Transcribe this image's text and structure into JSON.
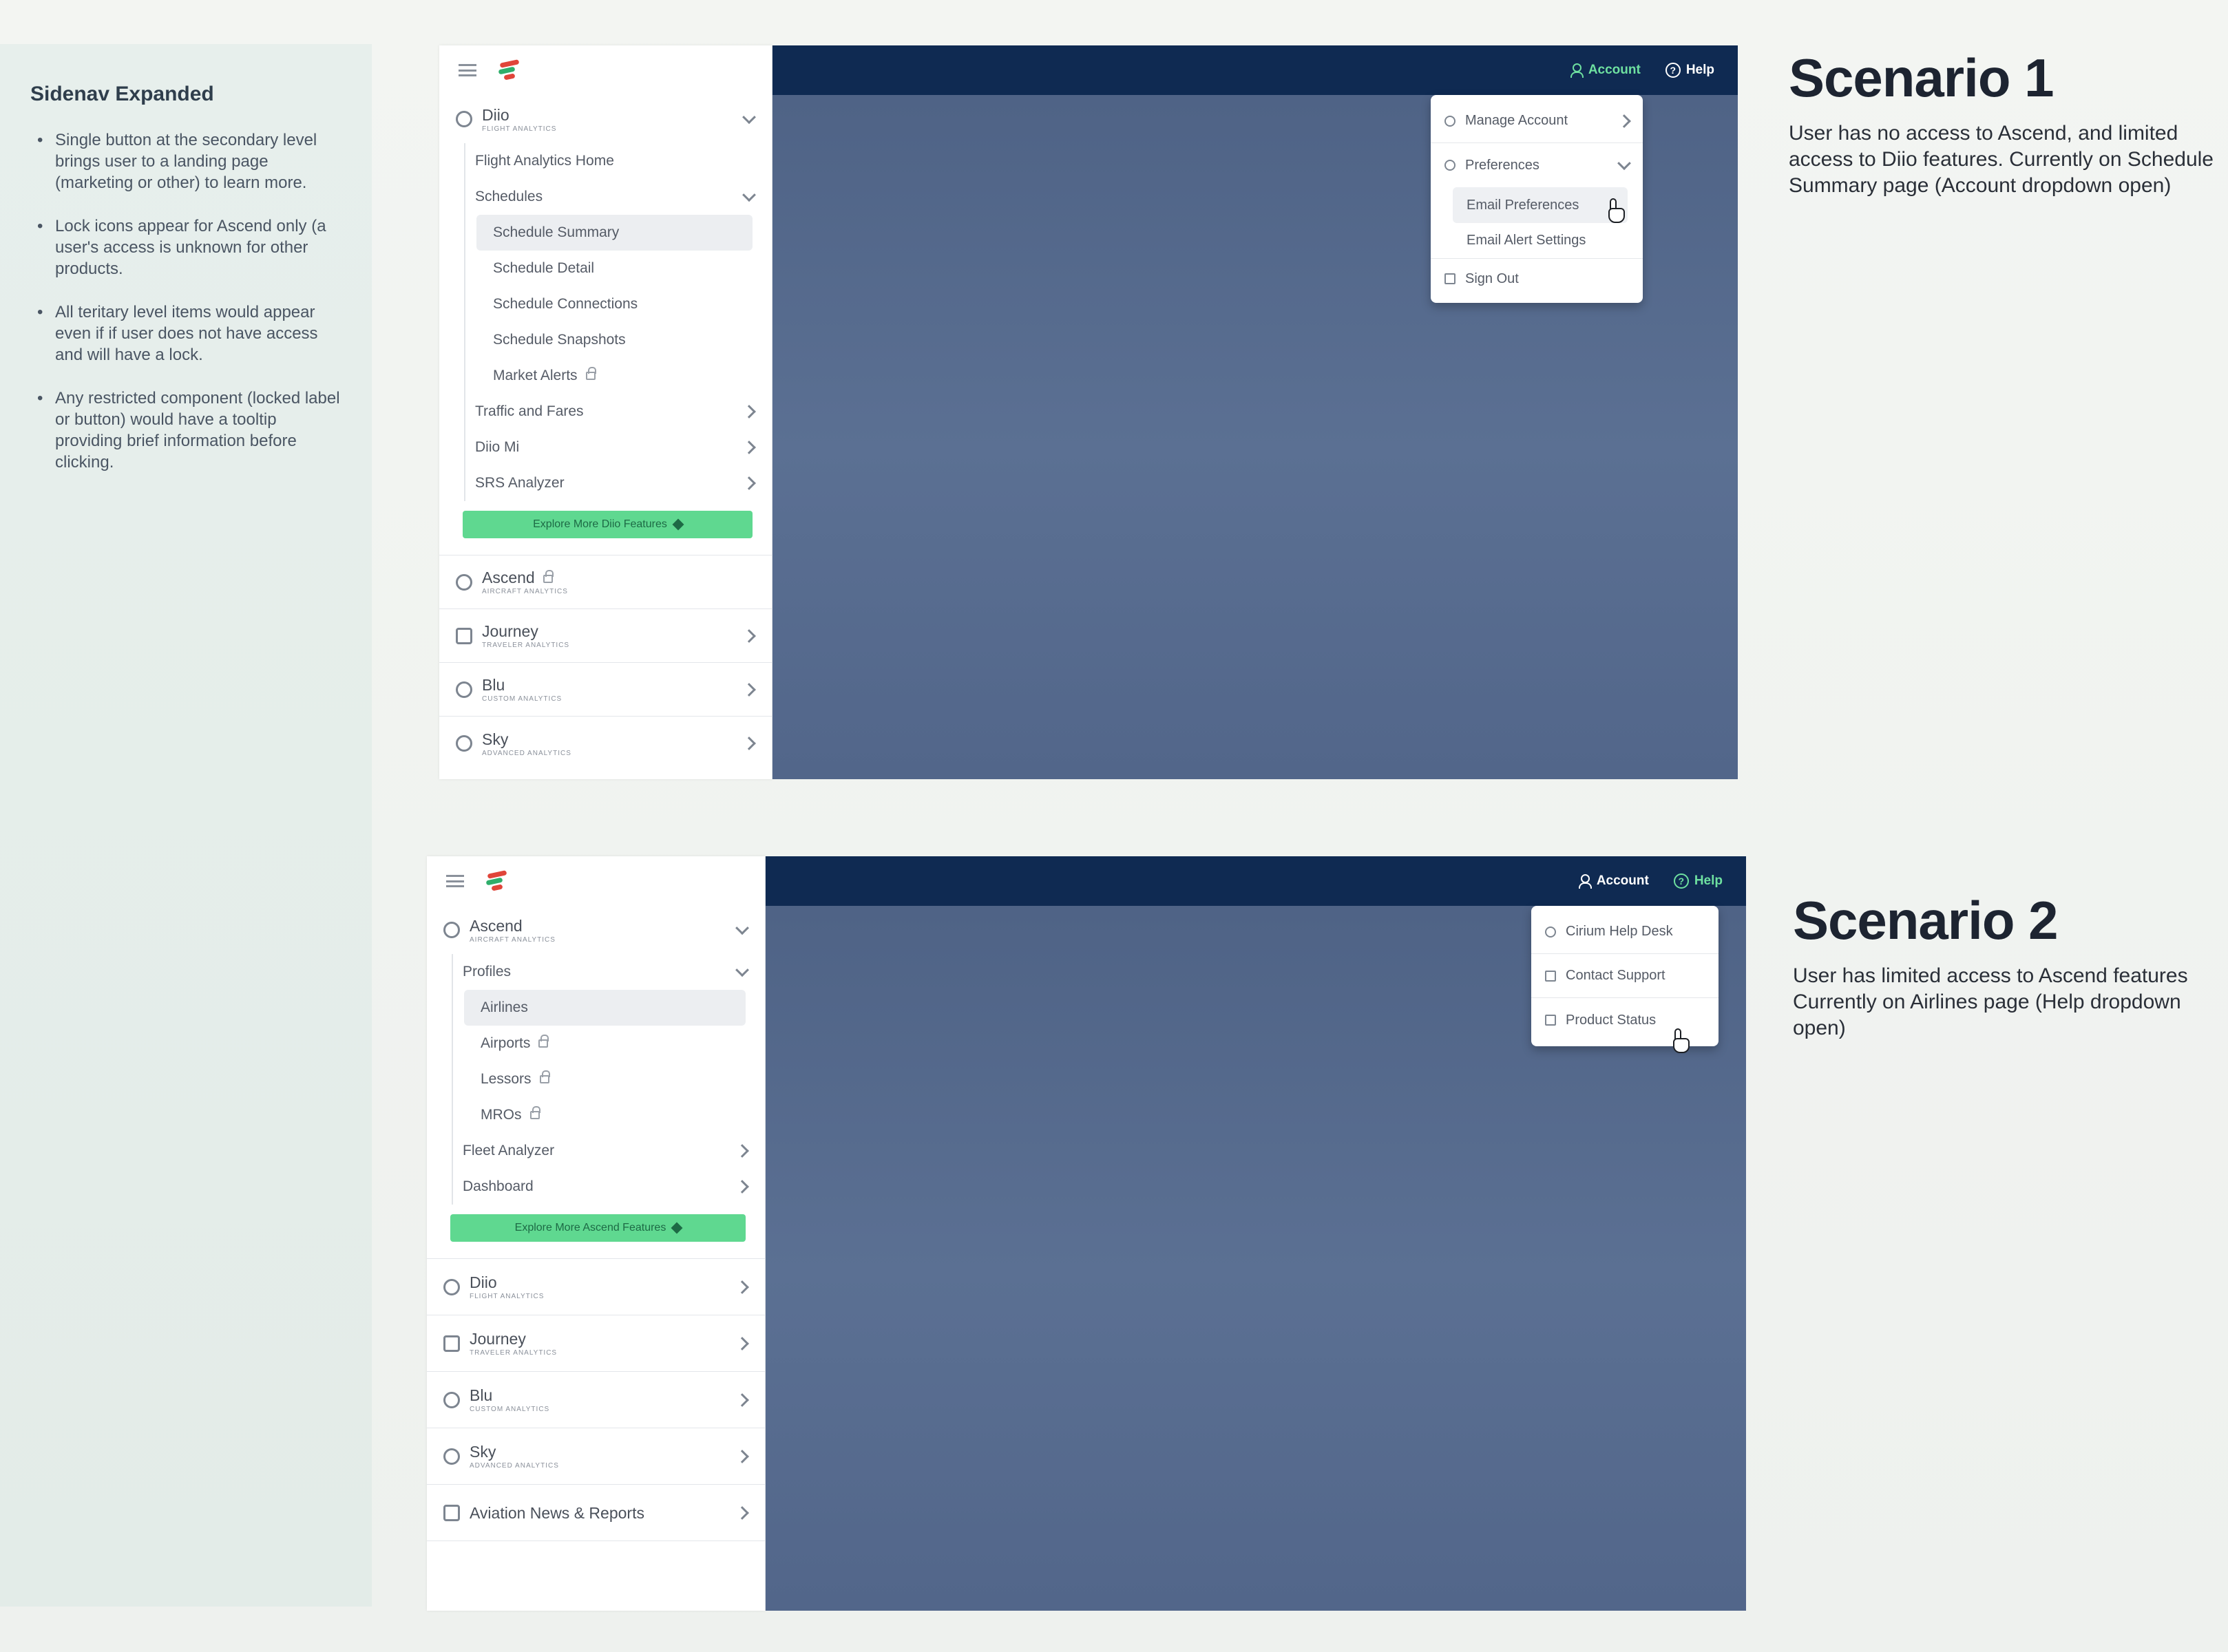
{
  "notes": {
    "title": "Sidenav Expanded",
    "bullets": [
      "Single button at the secondary level brings user to a landing page (marketing or other) to learn more.",
      "Lock icons appear for Ascend only (a user's access is unknown for other products.",
      "All teritary level items would appear even if if user does not have access and will have a lock.",
      "Any restricted component (locked label or button) would have a tooltip providing brief information before clicking."
    ]
  },
  "s1": {
    "heading": "Scenario 1",
    "desc": "User has no access to Ascend, and limited access to Diio features. Currently on Schedule Summary page (Account dropdown open)",
    "topbar": {
      "account": "Account",
      "help": "Help"
    },
    "diio": {
      "name": "Diio",
      "sub": "FLIGHT ANALYTICS"
    },
    "items": {
      "home": "Flight Analytics Home",
      "schedules": "Schedules",
      "summary": "Schedule Summary",
      "detail": "Schedule Detail",
      "connections": "Schedule Connections",
      "snapshots": "Schedule Snapshots",
      "alerts": "Market Alerts",
      "traffic": "Traffic and Fares",
      "mi": "Diio Mi",
      "srs": "SRS Analyzer"
    },
    "explore": "Explore More Diio Features",
    "products": [
      {
        "name": "Ascend",
        "sub": "AIRCRAFT ANALYTICS"
      },
      {
        "name": "Journey",
        "sub": "TRAVELER ANALYTICS"
      },
      {
        "name": "Blu",
        "sub": "CUSTOM ANALYTICS"
      },
      {
        "name": "Sky",
        "sub": "ADVANCED ANALYTICS"
      }
    ],
    "dropdown": {
      "manage": "Manage Account",
      "prefs": "Preferences",
      "email_prefs": "Email Preferences",
      "email_alerts": "Email Alert Settings",
      "signout": "Sign Out"
    }
  },
  "s2": {
    "heading": "Scenario 2",
    "desc": "User has limited access to Ascend features Currently on Airlines page (Help dropdown open)",
    "topbar": {
      "account": "Account",
      "help": "Help"
    },
    "ascend": {
      "name": "Ascend",
      "sub": "AIRCRAFT ANALYTICS"
    },
    "items": {
      "profiles": "Profiles",
      "airlines": "Airlines",
      "airports": "Airports",
      "lessors": "Lessors",
      "mros": "MROs",
      "fleet": "Fleet Analyzer",
      "dashboard": "Dashboard"
    },
    "explore": "Explore More Ascend Features",
    "products": [
      {
        "name": "Diio",
        "sub": "FLIGHT ANALYTICS"
      },
      {
        "name": "Journey",
        "sub": "TRAVELER ANALYTICS"
      },
      {
        "name": "Blu",
        "sub": "CUSTOM ANALYTICS"
      },
      {
        "name": "Sky",
        "sub": "ADVANCED ANALYTICS"
      }
    ],
    "news": "Aviation News & Reports",
    "dropdown": {
      "helpdesk": "Cirium Help Desk",
      "contact": "Contact Support",
      "status": "Product Status"
    }
  }
}
